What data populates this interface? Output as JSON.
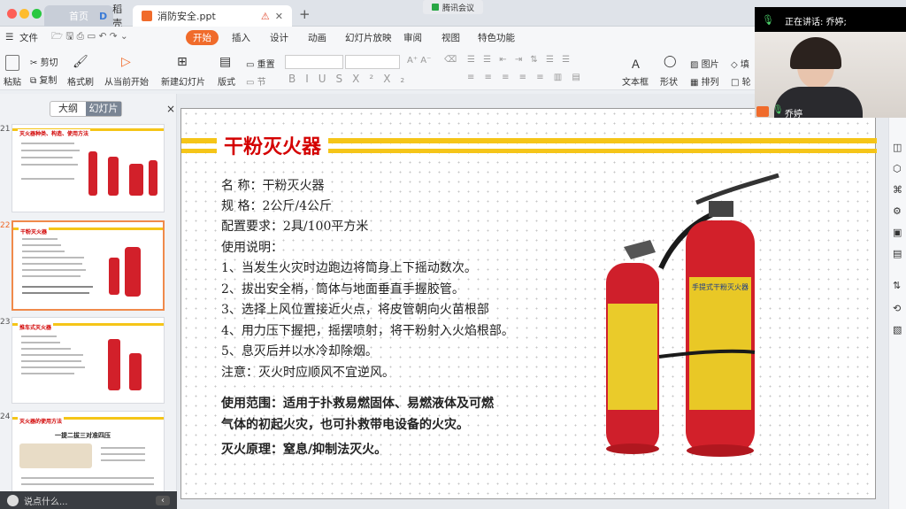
{
  "window": {
    "tabs": [
      {
        "label": "首页"
      },
      {
        "label": "稻壳"
      },
      {
        "label": "消防安全.ppt"
      }
    ],
    "new_tab": "+",
    "meeting": "腾讯会议"
  },
  "menu": {
    "file": "文件",
    "items": [
      "开始",
      "插入",
      "设计",
      "动画",
      "幻灯片放映",
      "审阅",
      "视图",
      "特色功能"
    ],
    "active": "开始"
  },
  "toolbar": {
    "paste": "粘贴",
    "cut": "剪切",
    "copy": "复制",
    "format_painter": "格式刷",
    "from_current": "从当前开始",
    "new_slide": "新建幻灯片",
    "layout": "版式",
    "reset": "重置",
    "section": "节",
    "textbox": "文本框",
    "shape": "形状",
    "picture": "图片",
    "arrange": "排列",
    "fill": "填",
    "outline": "轮"
  },
  "panel": {
    "outline_tab": "大纲",
    "slides_tab": "幻灯片",
    "close": "×",
    "thumbs": [
      {
        "num": "21",
        "title": "灭火器种类、构造、使用方法"
      },
      {
        "num": "22",
        "title": "干粉灭火器"
      },
      {
        "num": "23",
        "title": "推车式灭火器"
      },
      {
        "num": "24",
        "title": "灭火器的使用方法",
        "subtitle": "一提二拔三对准四压"
      }
    ]
  },
  "status": {
    "input_placeholder": "说点什么...",
    "collapse": "‹"
  },
  "video": {
    "speaking": "正在讲话: 乔婷;",
    "name": "乔婷"
  },
  "slide": {
    "title": "干粉灭火器",
    "lines": [
      "名    称：干粉灭火器",
      "规    格：2公斤/4公斤",
      "配置要求：2具/100平方米",
      "使用说明：",
      "1、当发生火灾时边跑边将筒身上下摇动数次。",
      "2、拔出安全梢，筒体与地面垂直手握胶管。",
      "3、选择上风位置接近火点，将皮管朝向火苗根部",
      "4、用力压下握把，摇摆喷射，将干粉射入火焰根部。",
      "5、息灭后并以水冷却除烟。",
      "注意：灭火时应顺风不宜逆风。"
    ],
    "scope_1": "使用范围：适用于扑救易燃固体、易燃液体及可燃",
    "scope_2": "气体的初起火灾，也可扑救带电设备的火灾。",
    "principle": "灭火原理：窒息/抑制法灭火。",
    "extinguisher_label": "手提式干粉灭火器"
  },
  "colors": {
    "accent": "#f5c518",
    "title_red": "#d40000",
    "tab_orange": "#f06b2b"
  }
}
